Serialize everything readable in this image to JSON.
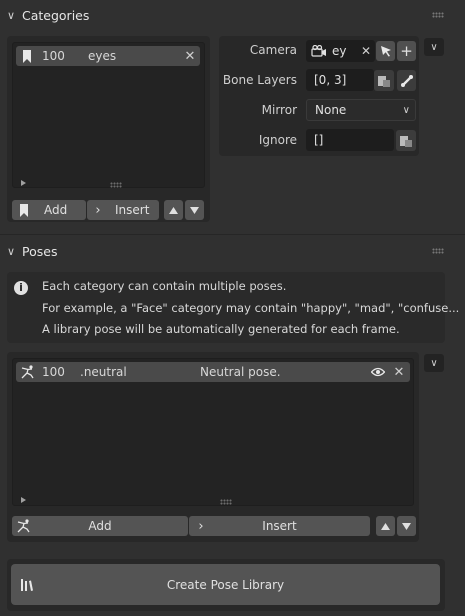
{
  "categories_panel": {
    "title": "Categories",
    "list": {
      "items": [
        {
          "number": "100",
          "name": "eyes"
        }
      ]
    },
    "add_label": "Add",
    "insert_label": "Insert"
  },
  "properties": {
    "camera_label": "Camera",
    "camera_value": "ey",
    "bone_layers_label": "Bone Layers",
    "bone_layers_value": "[0, 3]",
    "mirror_label": "Mirror",
    "mirror_value": "None",
    "ignore_label": "Ignore",
    "ignore_value": "[]"
  },
  "poses_panel": {
    "title": "Poses",
    "info_lines": [
      "Each category can contain multiple poses.",
      "For example, a \"Face\" category may contain \"happy\", \"mad\", \"confuse...",
      "A library pose will be automatically generated for each frame."
    ],
    "list": {
      "items": [
        {
          "number": "100",
          "name": ".neutral",
          "description": "Neutral pose."
        }
      ]
    },
    "add_label": "Add",
    "insert_label": "Insert"
  },
  "create_button_label": "Create Pose Library",
  "icons": {
    "bookmark": "bookmark-icon",
    "close": "close-icon",
    "camera": "camera-icon",
    "eyedropper": "eyedropper-icon",
    "plus": "plus-icon",
    "bone": "bone-icon",
    "pose": "pose-icon",
    "eye": "eye-icon",
    "info": "info-icon",
    "library": "library-icon"
  },
  "colors": {
    "background": "#303030",
    "panel": "#282828",
    "list": "#232323",
    "row": "#4a4a4a",
    "button": "#545454"
  }
}
